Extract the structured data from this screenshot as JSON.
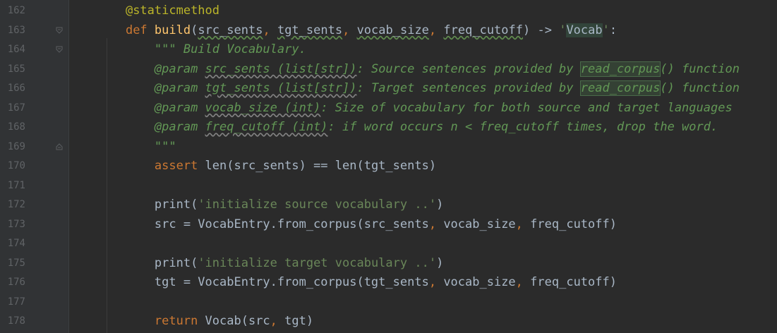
{
  "editor": {
    "lines": [
      {
        "num": "162",
        "segments": [
          {
            "t": "    ",
            "c": ""
          },
          {
            "t": "@staticmethod",
            "c": "dec"
          }
        ]
      },
      {
        "num": "163",
        "segments": [
          {
            "t": "    ",
            "c": ""
          },
          {
            "t": "def ",
            "c": "kw"
          },
          {
            "t": "build",
            "c": "fn"
          },
          {
            "t": "(",
            "c": ""
          },
          {
            "t": "src_sents",
            "c": "typo"
          },
          {
            "t": ", ",
            "c": "punc"
          },
          {
            "t": "tgt_sents",
            "c": "typo"
          },
          {
            "t": ", ",
            "c": "punc"
          },
          {
            "t": "vocab_size",
            "c": "typo"
          },
          {
            "t": ", ",
            "c": "punc"
          },
          {
            "t": "freq_cutoff",
            "c": "typo"
          },
          {
            "t": ") -> ",
            "c": ""
          },
          {
            "t": "'",
            "c": "str"
          },
          {
            "t": "Vocab",
            "c": "vocab-hl"
          },
          {
            "t": "'",
            "c": "str"
          },
          {
            "t": ":",
            "c": ""
          }
        ]
      },
      {
        "num": "164",
        "segments": [
          {
            "t": "        ",
            "c": ""
          },
          {
            "t": "\"\"\" Build Vocabulary.",
            "c": "doc"
          }
        ]
      },
      {
        "num": "165",
        "segments": [
          {
            "t": "        ",
            "c": ""
          },
          {
            "t": "@param ",
            "c": "doc"
          },
          {
            "t": "src_sents (list[str])",
            "c": "doc typo-doc"
          },
          {
            "t": ": Source sentences provided by ",
            "c": "doc"
          },
          {
            "t": "read_corpus",
            "c": "doc hl"
          },
          {
            "t": "() function",
            "c": "doc"
          }
        ]
      },
      {
        "num": "166",
        "segments": [
          {
            "t": "        ",
            "c": ""
          },
          {
            "t": "@param ",
            "c": "doc"
          },
          {
            "t": "tgt_sents (list[str])",
            "c": "doc typo-doc"
          },
          {
            "t": ": Target sentences provided by ",
            "c": "doc"
          },
          {
            "t": "read_corpus",
            "c": "doc hl"
          },
          {
            "t": "() function",
            "c": "doc"
          }
        ]
      },
      {
        "num": "167",
        "segments": [
          {
            "t": "        ",
            "c": ""
          },
          {
            "t": "@param ",
            "c": "doc"
          },
          {
            "t": "vocab_size (int)",
            "c": "doc typo-doc"
          },
          {
            "t": ": Size of vocabulary for both source and target languages",
            "c": "doc"
          }
        ]
      },
      {
        "num": "168",
        "segments": [
          {
            "t": "        ",
            "c": ""
          },
          {
            "t": "@param ",
            "c": "doc"
          },
          {
            "t": "freq_cutoff (int)",
            "c": "doc typo-doc"
          },
          {
            "t": ": if word occurs n < freq_cutoff times, drop the word.",
            "c": "doc"
          }
        ]
      },
      {
        "num": "169",
        "segments": [
          {
            "t": "        ",
            "c": ""
          },
          {
            "t": "\"\"\"",
            "c": "doc"
          }
        ]
      },
      {
        "num": "170",
        "segments": [
          {
            "t": "        ",
            "c": ""
          },
          {
            "t": "assert ",
            "c": "kw"
          },
          {
            "t": "len(src_sents) == len(tgt_sents)",
            "c": ""
          }
        ]
      },
      {
        "num": "171",
        "segments": []
      },
      {
        "num": "172",
        "segments": [
          {
            "t": "        ",
            "c": ""
          },
          {
            "t": "print(",
            "c": ""
          },
          {
            "t": "'initialize source vocabulary ..'",
            "c": "str"
          },
          {
            "t": ")",
            "c": ""
          }
        ]
      },
      {
        "num": "173",
        "segments": [
          {
            "t": "        ",
            "c": ""
          },
          {
            "t": "src = VocabEntry.from_corpus(src_sents",
            "c": ""
          },
          {
            "t": ", ",
            "c": "punc"
          },
          {
            "t": "vocab_size",
            "c": ""
          },
          {
            "t": ", ",
            "c": "punc"
          },
          {
            "t": "freq_cutoff)",
            "c": ""
          }
        ]
      },
      {
        "num": "174",
        "segments": []
      },
      {
        "num": "175",
        "segments": [
          {
            "t": "        ",
            "c": ""
          },
          {
            "t": "print(",
            "c": ""
          },
          {
            "t": "'initialize target vocabulary ..'",
            "c": "str"
          },
          {
            "t": ")",
            "c": ""
          }
        ]
      },
      {
        "num": "176",
        "segments": [
          {
            "t": "        ",
            "c": ""
          },
          {
            "t": "tgt = VocabEntry.from_corpus(tgt_sents",
            "c": ""
          },
          {
            "t": ", ",
            "c": "punc"
          },
          {
            "t": "vocab_size",
            "c": ""
          },
          {
            "t": ", ",
            "c": "punc"
          },
          {
            "t": "freq_cutoff)",
            "c": ""
          }
        ]
      },
      {
        "num": "177",
        "segments": []
      },
      {
        "num": "178",
        "segments": [
          {
            "t": "        ",
            "c": ""
          },
          {
            "t": "return ",
            "c": "kw"
          },
          {
            "t": "Vocab(src",
            "c": ""
          },
          {
            "t": ", ",
            "c": "punc"
          },
          {
            "t": "tgt)",
            "c": ""
          }
        ]
      }
    ],
    "fold_markers": [
      {
        "line": "163",
        "icon": "fold-open-icon"
      },
      {
        "line": "164",
        "icon": "fold-open-icon"
      },
      {
        "line": "169",
        "icon": "fold-close-icon"
      }
    ],
    "colors": {
      "background": "#2b2b2b",
      "gutter": "#313335",
      "keyword": "#cc7832",
      "decorator": "#bbb529",
      "function": "#ffc66d",
      "string": "#6a8759",
      "docstring": "#629755",
      "default": "#a9b7c6"
    }
  }
}
